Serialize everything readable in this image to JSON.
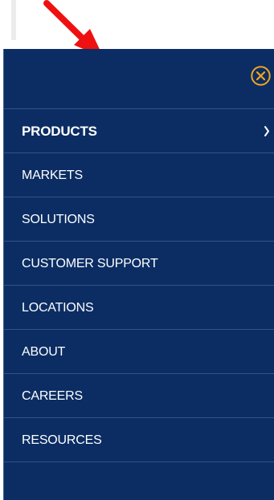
{
  "menu": {
    "items": [
      {
        "label": "PRODUCTS",
        "has_submenu": true
      },
      {
        "label": "MARKETS",
        "has_submenu": false
      },
      {
        "label": "SOLUTIONS",
        "has_submenu": false
      },
      {
        "label": "CUSTOMER SUPPORT",
        "has_submenu": false
      },
      {
        "label": "LOCATIONS",
        "has_submenu": false
      },
      {
        "label": "ABOUT",
        "has_submenu": false
      },
      {
        "label": "CAREERS",
        "has_submenu": false
      },
      {
        "label": "RESOURCES",
        "has_submenu": false
      }
    ],
    "close_icon": "close-circle-icon",
    "submenu_icon": "chevron-right-icon"
  },
  "colors": {
    "panel_background": "#0b2d63",
    "close_accent": "#f2a51f",
    "text": "#ffffff",
    "arrow": "#ee1111"
  }
}
